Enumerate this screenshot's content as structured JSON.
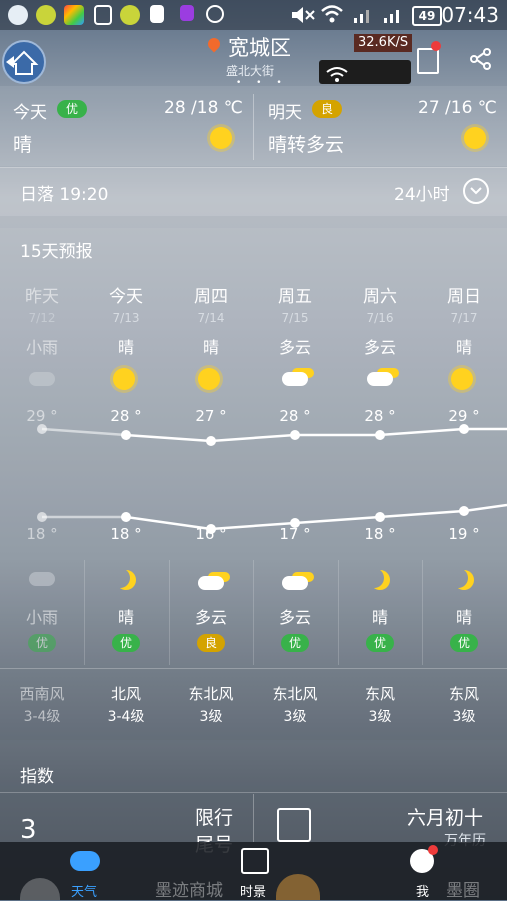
{
  "status_bar": {
    "time": "07:43",
    "battery": "49"
  },
  "header": {
    "city": "宽城区",
    "street": "盛北大街",
    "page_dots": "• • •",
    "net_speed": "32.6K/S"
  },
  "today": {
    "label": "今天",
    "aqi": "优",
    "temp": "28 /18 ℃",
    "cond": "晴"
  },
  "tomorrow": {
    "label": "明天",
    "aqi": "良",
    "temp": "27 /16 ℃",
    "cond": "晴转多云"
  },
  "sunset": {
    "text": "日落 19:20",
    "hours_label": "24小时"
  },
  "forecast": {
    "title": "15天预报",
    "days": [
      {
        "weekday": "昨天",
        "date": "7/12",
        "day_cond": "小雨",
        "high": "29 °",
        "low": "18 °",
        "night_cond": "小雨",
        "aqi": "优",
        "wind_dir": "西南风",
        "wind_lvl": "3-4级"
      },
      {
        "weekday": "今天",
        "date": "7/13",
        "day_cond": "晴",
        "high": "28 °",
        "low": "18 °",
        "night_cond": "晴",
        "aqi": "优",
        "wind_dir": "北风",
        "wind_lvl": "3-4级"
      },
      {
        "weekday": "周四",
        "date": "7/14",
        "day_cond": "晴",
        "high": "27 °",
        "low": "16 °",
        "night_cond": "多云",
        "aqi": "良",
        "wind_dir": "东北风",
        "wind_lvl": "3级"
      },
      {
        "weekday": "周五",
        "date": "7/15",
        "day_cond": "多云",
        "high": "28 °",
        "low": "17 °",
        "night_cond": "多云",
        "aqi": "优",
        "wind_dir": "东北风",
        "wind_lvl": "3级"
      },
      {
        "weekday": "周六",
        "date": "7/16",
        "day_cond": "多云",
        "high": "28 °",
        "low": "18 °",
        "night_cond": "晴",
        "aqi": "优",
        "wind_dir": "东风",
        "wind_lvl": "3级"
      },
      {
        "weekday": "周日",
        "date": "7/17",
        "day_cond": "晴",
        "high": "29 °",
        "low": "19 °",
        "night_cond": "晴",
        "aqi": "优",
        "wind_dir": "东风",
        "wind_lvl": "3级"
      }
    ],
    "high_values": [
      29,
      28,
      27,
      28,
      28,
      29,
      29
    ],
    "low_values": [
      18,
      18,
      16,
      17,
      18,
      19,
      20
    ]
  },
  "index": {
    "title": "指数",
    "number": "3",
    "limit_line1": "限行",
    "limit_line2": "尾号",
    "lunar": "六月初十",
    "almanac": "万年历"
  },
  "bottom_nav": {
    "weather": "天气",
    "scenery": "时景",
    "me": "我",
    "shop": "墨迹商城",
    "circle": "墨圈"
  },
  "colors": {
    "aqi_good": "#38b24a",
    "aqi_mid": "#d4a300",
    "sun": "#ffd21f",
    "nav_active": "#3aa0ff"
  }
}
